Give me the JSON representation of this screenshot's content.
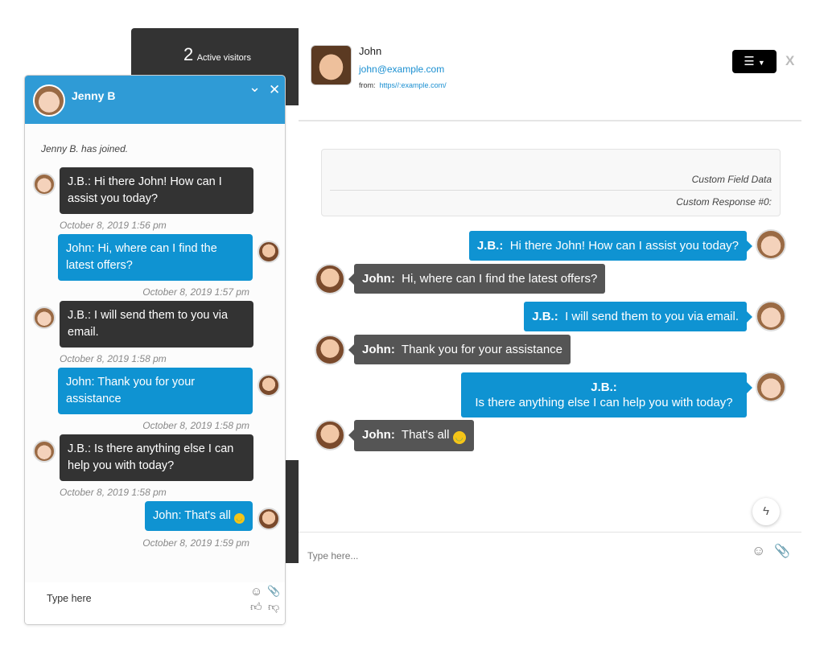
{
  "visitors": {
    "count": "2",
    "label": "Active visitors"
  },
  "widget": {
    "agent_name": "Jenny B",
    "joined": "Jenny B. has joined.",
    "input_placeholder": "Type here",
    "messages": [
      {
        "from": "agent",
        "text": "J.B.:  Hi there John! How can I assist you today?",
        "time": "October 8, 2019 1:56 pm"
      },
      {
        "from": "visitor",
        "text": "John: Hi, where can I find the latest offers?",
        "time": "October 8, 2019 1:57 pm"
      },
      {
        "from": "agent",
        "text": "J.B.:  I will send them to you via email.",
        "time": "October 8, 2019 1:58 pm"
      },
      {
        "from": "visitor",
        "text": "John: Thank you for your assistance",
        "time": "October 8, 2019 1:58 pm"
      },
      {
        "from": "agent",
        "text": "J.B.:  Is there anything else I can help you with today?",
        "time": "October 8, 2019 1:58 pm"
      },
      {
        "from": "visitor",
        "text": "John: That's all",
        "time": "October 8, 2019 1:59 pm"
      }
    ]
  },
  "visitor": {
    "name": "John",
    "email": "john@example.com",
    "from_label": "from:",
    "from_url": "https//:example.com/"
  },
  "custom": {
    "field": "Custom Field Data",
    "response": "Custom Response #0:"
  },
  "conversation": [
    {
      "who": "J.B.:",
      "text": "Hi there John! How can I assist you today?"
    },
    {
      "who": "John:",
      "text": "Hi, where can I find the latest offers?"
    },
    {
      "who": "J.B.:",
      "text": "I will send them to you via email."
    },
    {
      "who": "John:",
      "text": "Thank you for your assistance"
    },
    {
      "who": "J.B.:",
      "text": "Is there anything else I can help you with today?"
    },
    {
      "who": "John:",
      "text": "That's all"
    }
  ],
  "agent_input_placeholder": "Type here...",
  "close_label": "X",
  "colors": {
    "widget_header": "#2f9bd6",
    "agent_bubble": "#333333",
    "visitor_bubble": "#0f93d2",
    "console_gray": "#555555"
  }
}
